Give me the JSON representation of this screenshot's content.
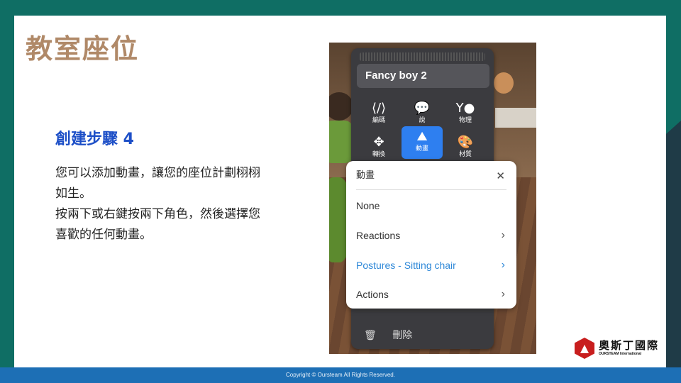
{
  "slide": {
    "title": "教室座位",
    "step_heading": "創建步驟 4",
    "body_lines": [
      "您可以添加動畫，讓您的座位計劃栩栩",
      "如生。",
      "按兩下或右鍵按兩下角色，然後選擇您",
      "喜歡的任何動畫。"
    ]
  },
  "footer": {
    "copyright": "Copyright © Oursteam All Rights Reserved."
  },
  "logo": {
    "name": "奧斯丁國際",
    "sub": "OURSTEAM International"
  },
  "app": {
    "character_name": "Fancy boy 2",
    "tools": [
      {
        "icon": "code-icon",
        "glyph": "⟨/⟩",
        "label": "編碼"
      },
      {
        "icon": "speech-bubble-icon",
        "glyph": "💬",
        "label": "說"
      },
      {
        "icon": "physics-icon",
        "glyph": "Y●",
        "label": "物理"
      },
      {
        "icon": "move-arrows-icon",
        "glyph": "✥",
        "label": "轉換"
      },
      {
        "icon": "animation-icon",
        "glyph": "⛰",
        "label": "動畫"
      },
      {
        "icon": "palette-icon",
        "glyph": "🎨",
        "label": "材質"
      }
    ],
    "active_tool": "動畫",
    "menu": {
      "title": "動畫",
      "close_glyph": "✕",
      "items": [
        {
          "label": "None",
          "has_submenu": false
        },
        {
          "label": "Reactions",
          "has_submenu": true
        },
        {
          "label": "Postures - Sitting chair",
          "has_submenu": true,
          "selected": true
        },
        {
          "label": "Actions",
          "has_submenu": true
        }
      ],
      "chevron_glyph": "›"
    },
    "delete_label": "刪除",
    "delete_glyph": "🗑",
    "accent_color": "#2e7ff0",
    "selected_color": "#2e88d8"
  },
  "colors": {
    "title": "#b08968",
    "step_heading": "#1d4fc7",
    "footer_bar": "#1d6fb5",
    "background": "#0f6e64"
  }
}
